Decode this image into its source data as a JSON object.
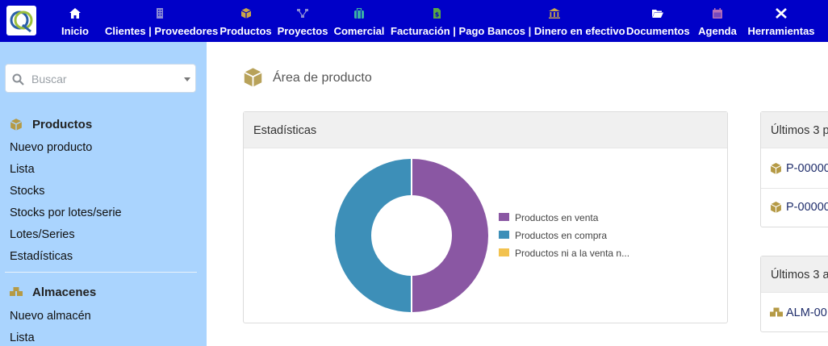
{
  "topbar": {
    "items": [
      {
        "label": "Inicio",
        "icon": "home-icon"
      },
      {
        "label": "Clientes | Proveedores",
        "icon": "building-icon"
      },
      {
        "label": "Productos",
        "icon": "cube-icon"
      },
      {
        "label": "Proyectos",
        "icon": "sitemap-icon"
      },
      {
        "label": "Comercial",
        "icon": "suitcase-icon"
      },
      {
        "label": "Facturación | Pago",
        "icon": "invoice-icon"
      },
      {
        "label": "Bancos | Dinero en efectivo",
        "icon": "bank-icon"
      },
      {
        "label": "Documentos",
        "icon": "folder-open-icon"
      },
      {
        "label": "Agenda",
        "icon": "calendar-icon"
      },
      {
        "label": "Herramientas",
        "icon": "tools-icon"
      }
    ],
    "colors": {
      "bar": "#0000c8"
    }
  },
  "sidebar": {
    "search": {
      "placeholder": "Buscar"
    },
    "sections": [
      {
        "title": "Productos",
        "icon": "cube-icon",
        "links": [
          "Nuevo producto",
          "Lista",
          "Stocks",
          "Stocks por lotes/serie",
          "Lotes/Series",
          "Estadísticas"
        ]
      },
      {
        "title": "Almacenes",
        "icon": "boxes-icon",
        "links": [
          "Nuevo almacén",
          "Lista"
        ]
      }
    ]
  },
  "main": {
    "title": "Área de producto",
    "title_icon": "cube-icon",
    "stats_card": {
      "title": "Estadísticas"
    },
    "latest_products": {
      "title": "Últimos 3 p",
      "rows": [
        "P-00000",
        "P-00000"
      ]
    },
    "latest_warehouses": {
      "title": "Últimos 3 a",
      "rows": [
        "ALM-00"
      ]
    }
  },
  "chart_data": {
    "type": "pie",
    "title": "",
    "categories": [
      "Productos en venta",
      "Productos en compra",
      "Productos ni a la venta n..."
    ],
    "values": [
      50,
      50,
      0
    ],
    "colors": [
      "#8a57a3",
      "#3d8fb8",
      "#f2c24f"
    ],
    "style": "donut",
    "legend_position": "right"
  }
}
